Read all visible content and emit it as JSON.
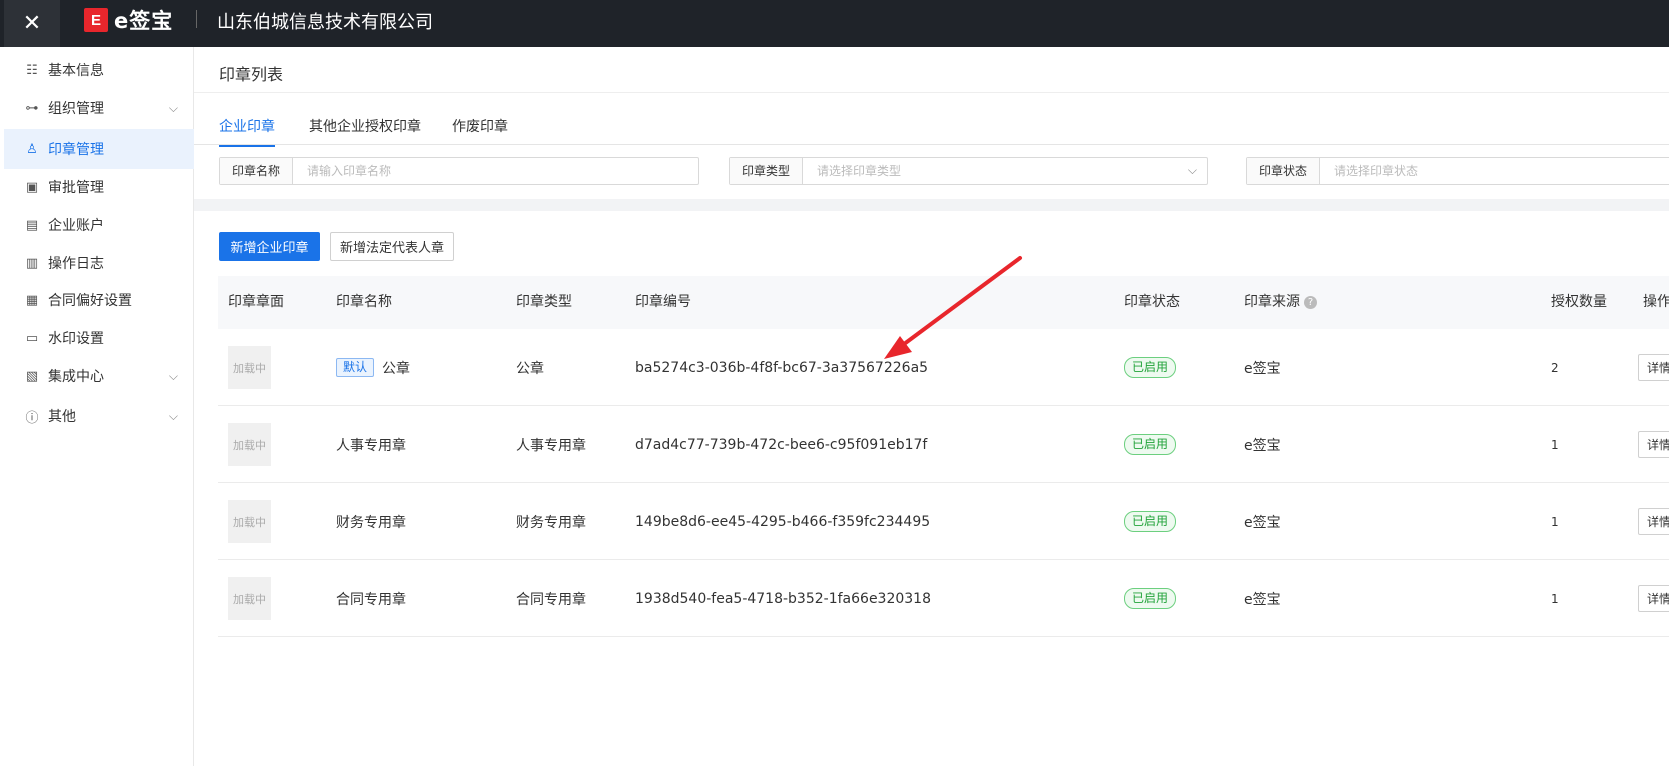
{
  "topbar": {
    "close_icon": "close-icon",
    "logo_mark": "E",
    "logo_text": "e签宝",
    "company": "山东伯城信息技术有限公司"
  },
  "sidebar": {
    "items": [
      {
        "label": "基本信息",
        "icon": "info-card-icon",
        "glyph": "☷",
        "expandable": false,
        "active": false
      },
      {
        "label": "组织管理",
        "icon": "org-tree-icon",
        "glyph": "⊶",
        "expandable": true,
        "active": false
      },
      {
        "label": "印章管理",
        "icon": "stamp-icon",
        "glyph": "♙",
        "expandable": false,
        "active": true
      },
      {
        "label": "审批管理",
        "icon": "approval-icon",
        "glyph": "▣",
        "expandable": false,
        "active": false
      },
      {
        "label": "企业账户",
        "icon": "building-icon",
        "glyph": "▤",
        "expandable": false,
        "active": false
      },
      {
        "label": "操作日志",
        "icon": "log-icon",
        "glyph": "▥",
        "expandable": false,
        "active": false
      },
      {
        "label": "合同偏好设置",
        "icon": "contract-icon",
        "glyph": "▦",
        "expandable": false,
        "active": false
      },
      {
        "label": "水印设置",
        "icon": "watermark-icon",
        "glyph": "▭",
        "expandable": false,
        "active": false
      },
      {
        "label": "集成中心",
        "icon": "integration-icon",
        "glyph": "▧",
        "expandable": true,
        "active": false
      },
      {
        "label": "其他",
        "icon": "info-circle-icon",
        "glyph": "ⓘ",
        "expandable": true,
        "active": false
      }
    ],
    "chevron": "⌵"
  },
  "main": {
    "title": "印章列表",
    "tabs": [
      {
        "label": "企业印章",
        "active": true
      },
      {
        "label": "其他企业授权印章",
        "active": false
      },
      {
        "label": "作废印章",
        "active": false
      }
    ],
    "filters": [
      {
        "label": "印章名称",
        "placeholder": "请输入印章名称",
        "dropdown": false
      },
      {
        "label": "印章类型",
        "placeholder": "请选择印章类型",
        "dropdown": true
      },
      {
        "label": "印章状态",
        "placeholder": "请选择印章状态",
        "dropdown": true
      }
    ],
    "buttons": {
      "add_seal": "新增企业印章",
      "add_legal_seal": "新增法定代表人章"
    }
  },
  "table": {
    "headers": {
      "face": "印章章面",
      "name": "印章名称",
      "type": "印章类型",
      "code": "印章编号",
      "status": "印章状态",
      "source": "印章来源",
      "source_help": "?",
      "auth_count": "授权数量",
      "action": "操作"
    },
    "rows": [
      {
        "face": "加载中",
        "default_tag": "默认",
        "name": "公章",
        "type": "公章",
        "code": "ba5274c3-036b-4f8f-bc67-3a37567226a5",
        "status": "已启用",
        "source": "e签宝",
        "auth_count": "2",
        "action": "详情"
      },
      {
        "face": "加载中",
        "default_tag": "",
        "name": "人事专用章",
        "type": "人事专用章",
        "code": "d7ad4c77-739b-472c-bee6-c95f091eb17f",
        "status": "已启用",
        "source": "e签宝",
        "auth_count": "1",
        "action": "详情"
      },
      {
        "face": "加载中",
        "default_tag": "",
        "name": "财务专用章",
        "type": "财务专用章",
        "code": "149be8d6-ee45-4295-b466-f359fc234495",
        "status": "已启用",
        "source": "e签宝",
        "auth_count": "1",
        "action": "详情"
      },
      {
        "face": "加载中",
        "default_tag": "",
        "name": "合同专用章",
        "type": "合同专用章",
        "code": "1938d540-fea5-4718-b352-1fa66e320318",
        "status": "已启用",
        "source": "e签宝",
        "auth_count": "1",
        "action": "详情"
      }
    ]
  },
  "colors": {
    "accent": "#1a73e8",
    "topbar": "#1f2329",
    "status_green": "#22a33a",
    "annotation_arrow": "#e8262c"
  }
}
